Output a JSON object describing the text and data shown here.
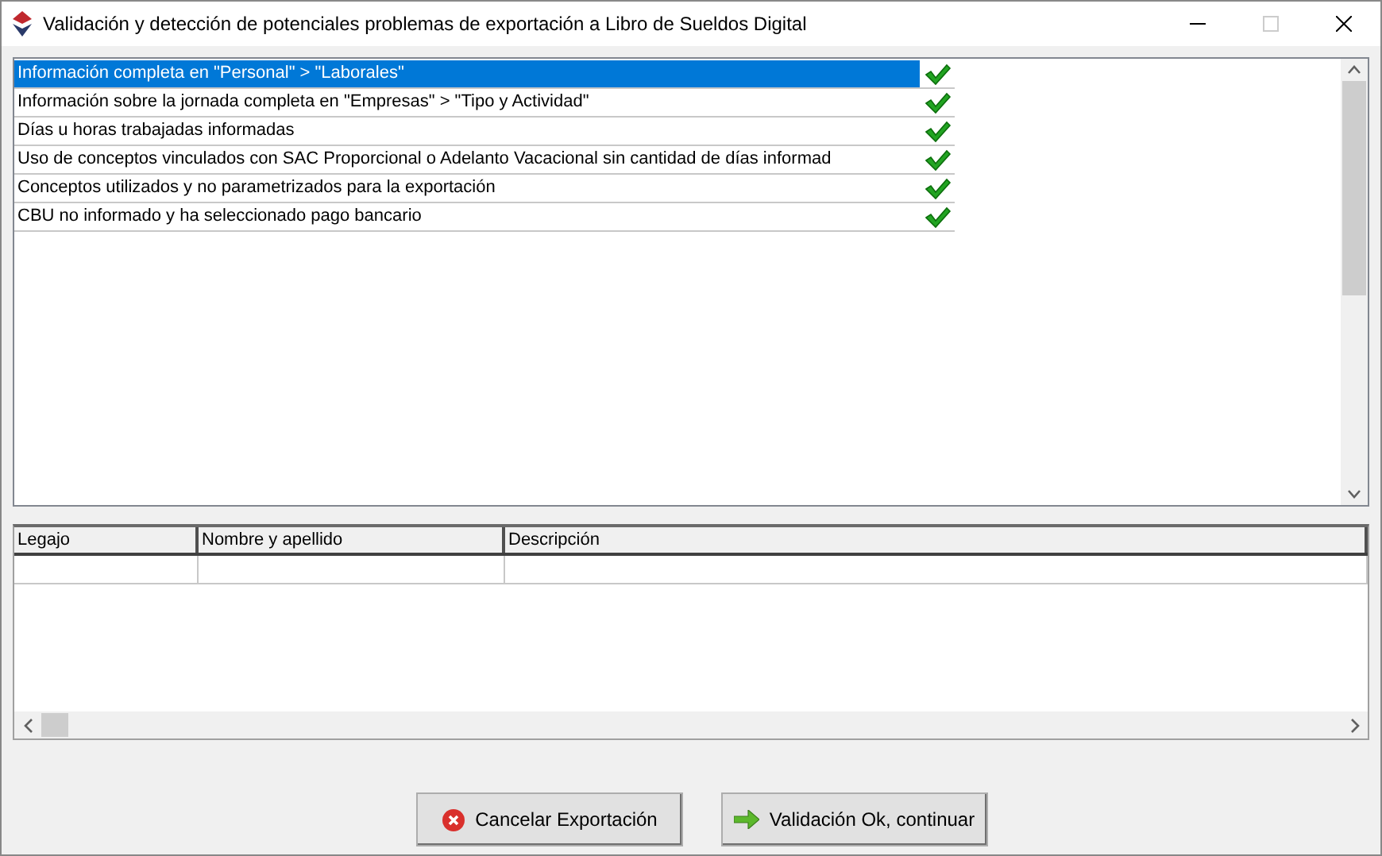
{
  "window": {
    "title": "Validación y detección de potenciales problemas de exportación a Libro de Sueldos Digital"
  },
  "checks": [
    {
      "label": "Información completa en \"Personal\" > \"Laborales\"",
      "selected": true,
      "checked": true
    },
    {
      "label": "Información sobre la jornada completa en \"Empresas\" > \"Tipo y Actividad\"",
      "selected": false,
      "checked": true
    },
    {
      "label": "Días u horas trabajadas informadas",
      "selected": false,
      "checked": true
    },
    {
      "label": "Uso de conceptos vinculados con SAC Proporcional o Adelanto Vacacional sin cantidad de días informad",
      "selected": false,
      "checked": true
    },
    {
      "label": "Conceptos utilizados y no parametrizados para la exportación",
      "selected": false,
      "checked": true
    },
    {
      "label": "CBU no informado y ha seleccionado pago bancario",
      "selected": false,
      "checked": true
    }
  ],
  "table": {
    "columns": [
      "Legajo",
      "Nombre y apellido",
      "Descripción"
    ]
  },
  "buttons": [
    {
      "label": "Cancelar Exportación",
      "kind": "cancel"
    },
    {
      "label": "Validación Ok, continuar",
      "kind": "ok"
    }
  ]
}
